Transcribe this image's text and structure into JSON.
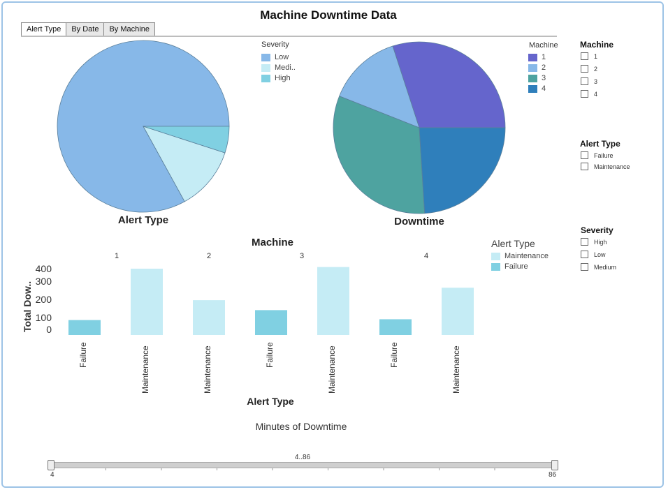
{
  "title": "Machine Downtime Data",
  "tabs": [
    {
      "label": "Alert Type",
      "active": true
    },
    {
      "label": "By Date",
      "active": false
    },
    {
      "label": "By Machine",
      "active": false
    }
  ],
  "pie_severity": {
    "legend_title": "Severity",
    "caption": "Alert Type",
    "items": [
      {
        "label": "Low",
        "color": "#87b8e8"
      },
      {
        "label": "Medi..",
        "color": "#c5ecf5"
      },
      {
        "label": "High",
        "color": "#80d0e2"
      }
    ]
  },
  "pie_machine": {
    "legend_title": "Machine",
    "caption": "Downtime",
    "items": [
      {
        "label": "1",
        "color": "#6565cc"
      },
      {
        "label": "2",
        "color": "#87b8e8"
      },
      {
        "label": "3",
        "color": "#4ea3a0"
      },
      {
        "label": "4",
        "color": "#2f7fbb"
      }
    ]
  },
  "bar_chart": {
    "title": "Machine",
    "ylabel": "Total Dow..",
    "xlabel": "Alert Type",
    "legend_title": "Alert Type",
    "legend": [
      {
        "label": "Maintenance",
        "color": "#c5ecf5"
      },
      {
        "label": "Failure",
        "color": "#80d0e2"
      }
    ],
    "machines": [
      "1",
      "2",
      "3",
      "4"
    ],
    "yticks": [
      "400",
      "300",
      "200",
      "100",
      "0"
    ]
  },
  "filters": {
    "machine": {
      "title": "Machine",
      "items": [
        "1",
        "2",
        "3",
        "4"
      ]
    },
    "alert_type": {
      "title": "Alert Type",
      "items": [
        "Failure",
        "Maintenance"
      ]
    },
    "severity": {
      "title": "Severity",
      "items": [
        "High",
        "Low",
        "Medium"
      ]
    }
  },
  "slider": {
    "title": "Minutes of Downtime",
    "range_label": "4..86",
    "min_label": "4",
    "max_label": "86",
    "low": 4,
    "high": 86
  },
  "chart_data": [
    {
      "type": "pie",
      "title": "Alert Type",
      "legend_title": "Severity",
      "slices": [
        {
          "label": "Low",
          "value": 83,
          "color": "#87b8e8"
        },
        {
          "label": "Medi..",
          "value": 12,
          "color": "#c5ecf5"
        },
        {
          "label": "High",
          "value": 5,
          "color": "#80d0e2"
        }
      ]
    },
    {
      "type": "pie",
      "title": "Downtime",
      "legend_title": "Machine",
      "slices": [
        {
          "label": "1",
          "value": 30,
          "color": "#6565cc"
        },
        {
          "label": "2",
          "value": 14,
          "color": "#87b8e8"
        },
        {
          "label": "3",
          "value": 32,
          "color": "#4ea3a0"
        },
        {
          "label": "4",
          "value": 24,
          "color": "#2f7fbb"
        }
      ]
    },
    {
      "type": "bar",
      "title": "Machine",
      "xlabel": "Alert Type",
      "ylabel": "Total Dow..",
      "ylim": [
        0,
        400
      ],
      "groups": [
        {
          "machine": "1",
          "bars": [
            {
              "category": "Failure",
              "value": 90
            },
            {
              "category": "Maintenance",
              "value": 400
            }
          ]
        },
        {
          "machine": "2",
          "bars": [
            {
              "category": "Maintenance",
              "value": 210
            }
          ]
        },
        {
          "machine": "3",
          "bars": [
            {
              "category": "Failure",
              "value": 150
            },
            {
              "category": "Maintenance",
              "value": 410
            }
          ]
        },
        {
          "machine": "4",
          "bars": [
            {
              "category": "Failure",
              "value": 95
            },
            {
              "category": "Maintenance",
              "value": 285
            }
          ]
        }
      ],
      "colors": {
        "Failure": "#80d0e2",
        "Maintenance": "#c5ecf5"
      }
    }
  ]
}
